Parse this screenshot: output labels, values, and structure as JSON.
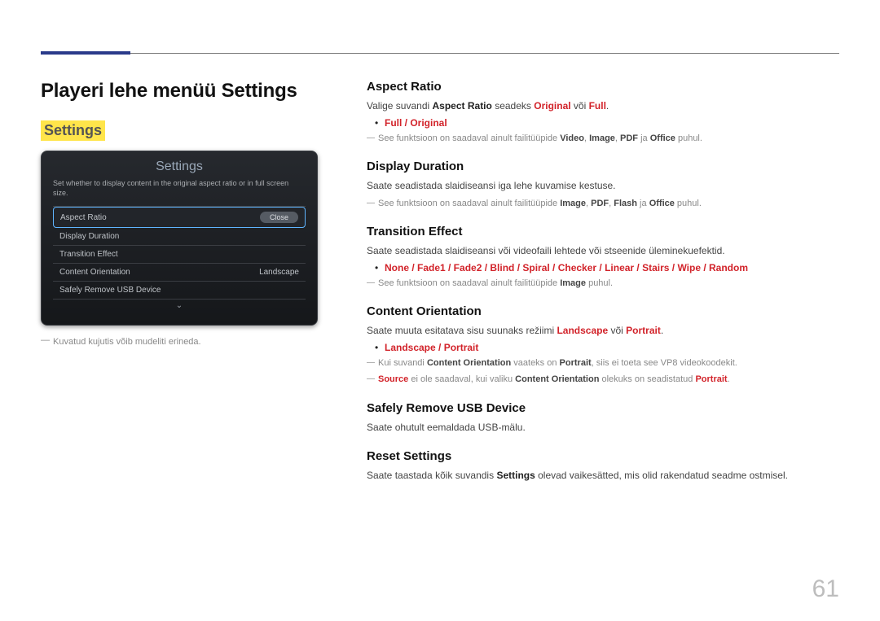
{
  "page": {
    "number": "61"
  },
  "heading": "Playeri lehe menüü Settings",
  "settings_label": "Settings",
  "panel": {
    "title": "Settings",
    "desc": "Set whether to display content in the original aspect ratio or in full screen size.",
    "items": [
      {
        "label": "Aspect Ratio",
        "right": ""
      },
      {
        "label": "Display Duration",
        "right": ""
      },
      {
        "label": "Transition Effect",
        "right": ""
      },
      {
        "label": "Content Orientation",
        "right": "Landscape"
      },
      {
        "label": "Safely Remove USB Device",
        "right": ""
      }
    ],
    "close": "Close"
  },
  "left_note": "Kuvatud kujutis võib mudeliti erineda.",
  "sections": {
    "aspect": {
      "title": "Aspect Ratio",
      "line_pre": "Valige suvandi ",
      "line_b1": "Aspect Ratio",
      "line_mid": " seadeks ",
      "line_r1": "Original",
      "line_or": " või ",
      "line_r2": "Full",
      "line_end": ".",
      "bullet": "Full / Original",
      "note_pre": "See funktsioon on saadaval ainult failitüüpide ",
      "note_v": "Video",
      "note_c1": ", ",
      "note_i": "Image",
      "note_c2": ", ",
      "note_p": "PDF",
      "note_c3": " ja ",
      "note_o": "Office",
      "note_end": " puhul."
    },
    "display": {
      "title": "Display Duration",
      "line": "Saate seadistada slaidiseansi iga lehe kuvamise kestuse.",
      "note_pre": "See funktsioon on saadaval ainult failitüüpide ",
      "n1": "Image",
      "c1": ", ",
      "n2": "PDF",
      "c2": ", ",
      "n3": "Flash",
      "c3": " ja ",
      "n4": "Office",
      "note_end": " puhul."
    },
    "transition": {
      "title": "Transition Effect",
      "line": "Saate seadistada slaidiseansi või videofaili lehtede või stseenide üleminekuefektid.",
      "bullet": "None / Fade1 / Fade2 / Blind / Spiral / Checker / Linear / Stairs / Wipe / Random",
      "note_pre": "See funktsioon on saadaval ainult failitüüpide ",
      "n1": "Image",
      "note_end": " puhul."
    },
    "orientation": {
      "title": "Content Orientation",
      "line_pre": "Saate muuta esitatava sisu suunaks režiimi ",
      "r1": "Landscape",
      "or": " või ",
      "r2": "Portrait",
      "end": ".",
      "bullet": "Landscape / Portrait",
      "note1_pre": "Kui suvandi ",
      "note1_b": "Content Orientation",
      "note1_mid": " vaateks on ",
      "note1_b2": "Portrait",
      "note1_end": ", siis ei toeta see VP8 videokoodekit.",
      "note2_r1": "Source",
      "note2_mid": " ei ole saadaval, kui valiku ",
      "note2_b": "Content Orientation",
      "note2_mid2": " olekuks on seadistatud ",
      "note2_r2": "Portrait",
      "note2_end": "."
    },
    "usb": {
      "title": "Safely Remove USB Device",
      "line": "Saate ohutult eemaldada USB-mälu."
    },
    "reset": {
      "title": "Reset Settings",
      "line_pre": "Saate taastada kõik suvandis ",
      "b": "Settings",
      "line_end": " olevad vaikesätted, mis olid rakendatud seadme ostmisel."
    }
  }
}
